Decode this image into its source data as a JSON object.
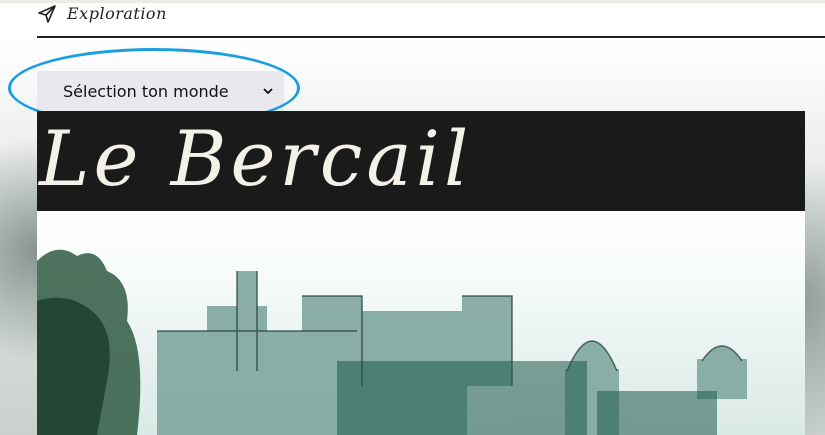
{
  "header": {
    "nav_title": "Exploration",
    "nav_icon": "send-icon"
  },
  "world_select": {
    "value": "Sélection ton monde",
    "icon": "chevron-down-icon"
  },
  "banner": {
    "title": "Le Bercail"
  },
  "colors": {
    "highlight": "#1b9ee0",
    "banner_bg": "#1a1a1a",
    "banner_text": "#f3f1ea",
    "select_bg": "#e9e8ec"
  }
}
